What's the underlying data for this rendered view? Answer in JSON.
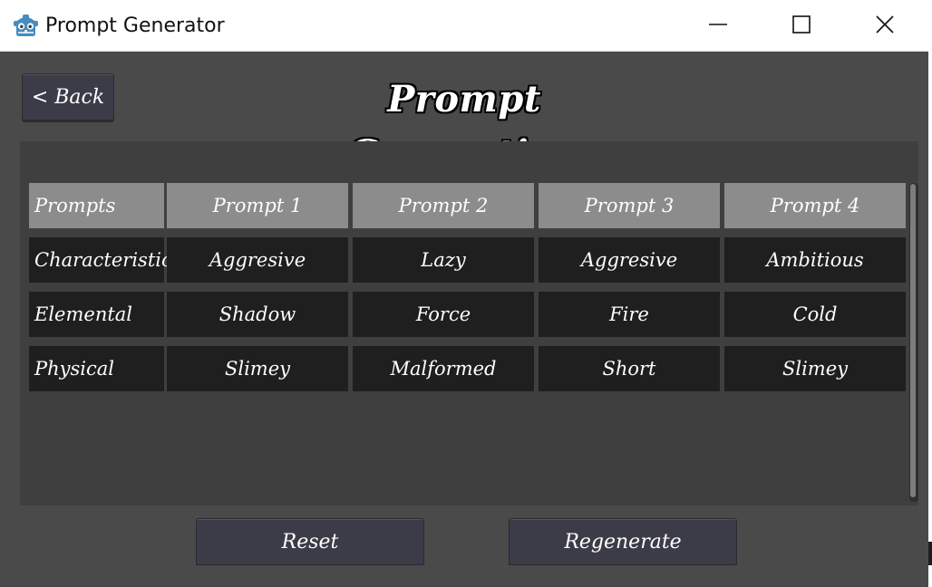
{
  "window": {
    "title": "Prompt Generator",
    "icon": "godot-robot-icon",
    "controls": [
      "minimize-icon",
      "maximize-icon",
      "close-icon"
    ]
  },
  "header": {
    "back_label": "<  Back",
    "title": "Prompt Generation"
  },
  "table": {
    "columns": [
      "Prompts",
      "Prompt 1",
      "Prompt 2",
      "Prompt 3",
      "Prompt 4"
    ],
    "rows": [
      {
        "label": "Characteristic:",
        "values": [
          "Aggresive",
          "Lazy",
          "Aggresive",
          "Ambitious"
        ]
      },
      {
        "label": "Elemental",
        "values": [
          "Shadow",
          "Force",
          "Fire",
          "Cold"
        ]
      },
      {
        "label": "Physical",
        "values": [
          "Slimey",
          "Malformed",
          "Short",
          "Slimey"
        ]
      }
    ]
  },
  "footer": {
    "reset_label": "Reset",
    "regenerate_label": "Regenerate"
  },
  "colors": {
    "background": "#4a4a4a",
    "panel": "#3f3f3f",
    "header_cell": "#8c8c8c",
    "body_cell": "#1f1f1f",
    "button": "#3c3b48",
    "text": "#ffffff"
  }
}
